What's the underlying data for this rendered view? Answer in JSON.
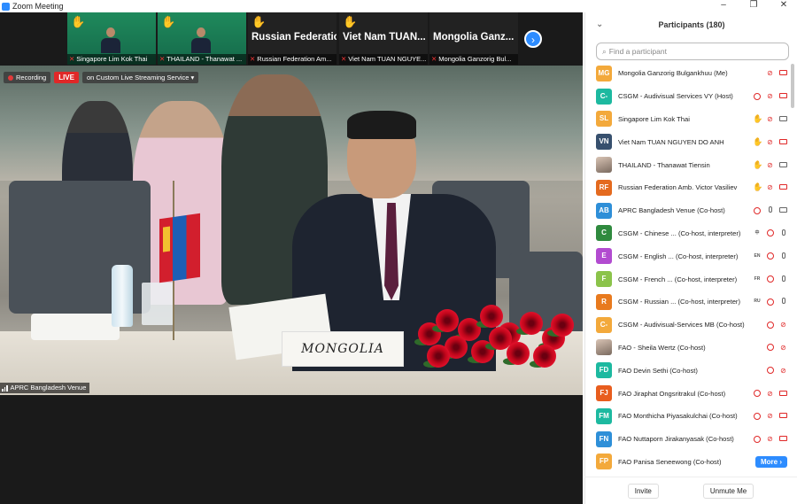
{
  "window": {
    "title": "Zoom Meeting",
    "controls": [
      "–",
      "❐",
      "✕"
    ]
  },
  "recording": {
    "label": "Recording",
    "live": "LIVE",
    "stream": "on Custom Live Streaming Service ▾"
  },
  "gallery": [
    {
      "name": "Singapore  Lim Kok Thai",
      "big": "",
      "hand": true
    },
    {
      "name": "THAILAND - Thanawat ...",
      "big": "",
      "hand": true
    },
    {
      "name": "Russian Federation Am...",
      "big": "Russian Federation...",
      "hand": true
    },
    {
      "name": "Viet Nam TUAN NGUYE...",
      "big": "Viet Nam TUAN...",
      "hand": true
    },
    {
      "name": "Mongolia Ganzorig Bul...",
      "big": "Mongolia Ganz...",
      "hand": false
    }
  ],
  "main_video": {
    "nameplate": "MONGOLIA",
    "venue_label": "APRC Bangladesh Venue"
  },
  "panel": {
    "title": "Participants (180)",
    "search_placeholder": "Find a participant",
    "more_label": "More ›",
    "invite_label": "Invite",
    "unmute_label": "Unmute Me"
  },
  "participants": [
    {
      "initials": "MG",
      "color": "#F3A93B",
      "name": "Mongolia Ganzorig Bulgankhuu (Me)",
      "icons": [
        "micoff",
        "camoff"
      ]
    },
    {
      "initials": "C-",
      "color": "#1DB9A0",
      "name": "CSGM - Audivisual Services VY (Host)",
      "icons": [
        "redc",
        "micoff",
        "camoff"
      ]
    },
    {
      "initials": "SL",
      "color": "#F3A93B",
      "name": "Singapore  Lim Kok Thai",
      "icons": [
        "hand",
        "micoff",
        "cam"
      ]
    },
    {
      "initials": "VN",
      "color": "#37506E",
      "name": "Viet Nam TUAN NGUYEN DO ANH",
      "icons": [
        "hand",
        "micoff",
        "camoff"
      ]
    },
    {
      "initials": "",
      "color": "photo",
      "name": "THAILAND - Thanawat Tiensin",
      "icons": [
        "hand",
        "micoff",
        "cam"
      ]
    },
    {
      "initials": "RF",
      "color": "#E46A1F",
      "name": "Russian Federation Amb. Victor Vasiliev",
      "icons": [
        "hand",
        "micoff",
        "camoff"
      ]
    },
    {
      "initials": "AB",
      "color": "#2E8FD8",
      "name": "APRC Bangladesh Venue (Co-host)",
      "icons": [
        "redc",
        "mic",
        "cam"
      ]
    },
    {
      "initials": "C",
      "color": "#2F8A3E",
      "name": "CSGM - Chinese ... (Co-host, interpreter)",
      "icons": [
        "lang",
        "redc",
        "mic"
      ],
      "lang": "中"
    },
    {
      "initials": "E",
      "color": "#B24BD0",
      "name": "CSGM - English ...  (Co-host, interpreter)",
      "icons": [
        "lang",
        "redc",
        "mic"
      ],
      "lang": "EN"
    },
    {
      "initials": "F",
      "color": "#8BC34A",
      "name": "CSGM - French ...  (Co-host, interpreter)",
      "icons": [
        "lang",
        "redc",
        "mic"
      ],
      "lang": "FR"
    },
    {
      "initials": "R",
      "color": "#E87A1E",
      "name": "CSGM - Russian ... (Co-host, interpreter)",
      "icons": [
        "lang",
        "redc",
        "mic"
      ],
      "lang": "RU"
    },
    {
      "initials": "C-",
      "color": "#F3A93B",
      "name": "CSGM - Audivisual-Services MB (Co-host)",
      "icons": [
        "redc",
        "micoff"
      ]
    },
    {
      "initials": "",
      "color": "photo",
      "name": "FAO - Sheila Wertz (Co-host)",
      "icons": [
        "redc",
        "micoff"
      ]
    },
    {
      "initials": "FD",
      "color": "#1DB9A0",
      "name": "FAO Devin Sethi (Co-host)",
      "icons": [
        "redc",
        "micoff"
      ]
    },
    {
      "initials": "FJ",
      "color": "#E85D1E",
      "name": "FAO Jiraphat Ongsritrakul (Co-host)",
      "icons": [
        "redc",
        "micoff",
        "camoff"
      ]
    },
    {
      "initials": "FM",
      "color": "#1DB9A0",
      "name": "FAO Monthicha Piyasakulchai (Co-host)",
      "icons": [
        "redc",
        "micoff",
        "camoff"
      ]
    },
    {
      "initials": "FN",
      "color": "#2E8FD8",
      "name": "FAO Nuttaporn Jirakanyasak (Co-host)",
      "icons": [
        "redc",
        "micoff",
        "camoff"
      ]
    },
    {
      "initials": "FP",
      "color": "#F3A93B",
      "name": "FAO Panisa Seneewong (Co-host)",
      "icons": []
    }
  ]
}
